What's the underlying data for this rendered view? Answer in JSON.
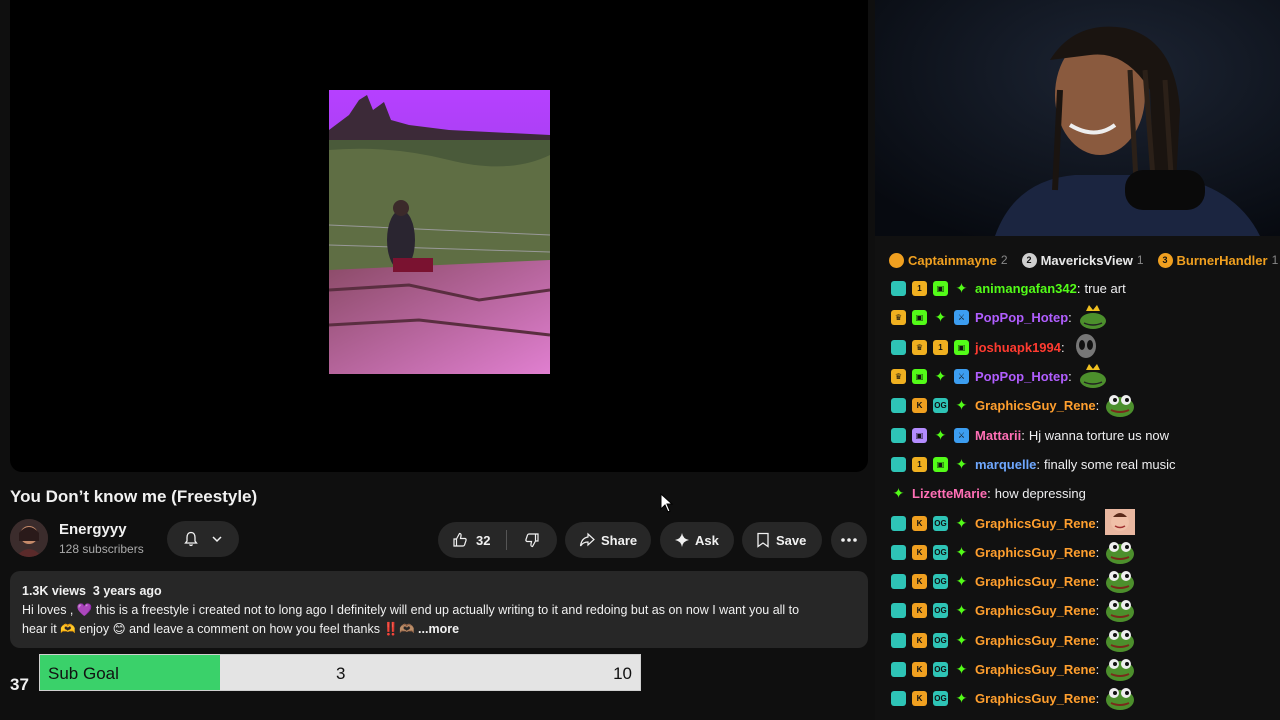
{
  "video": {
    "title": "You Don’t know me (Freestyle)",
    "channel_name": "Energyyy",
    "subscribers": "128 subscribers",
    "likes": "32",
    "share_label": "Share",
    "ask_label": "Ask",
    "save_label": "Save",
    "views": "1.3K views",
    "age": "3 years ago",
    "description_line1": "Hi loves ,  💜  this is a freestyle i created not to long ago I definitely will end up actually writing to it and redoing but as on now I want you all to",
    "description_line2": "hear it 🫶 enjoy 😊 and leave a comment on how you feel thanks ‼️🫶🏽",
    "more_label": "...more",
    "comments_count": "37"
  },
  "sub_goal": {
    "label": "Sub Goal",
    "current": "3",
    "target": "10",
    "progress": 0.3
  },
  "chat": {
    "top_gifters": [
      {
        "name": "Captainmayne",
        "count": "2",
        "rank": "",
        "color": "#f0a020"
      },
      {
        "name": "MavericksView",
        "count": "1",
        "rank": "2",
        "color": "#cfcfcf"
      },
      {
        "name": "BurnerHandler",
        "count": "1",
        "rank": "3",
        "color": "#f0a020"
      }
    ],
    "messages": [
      {
        "user": "animangafan342",
        "color": "#53fc18",
        "text": "true art",
        "badges": [
          "months",
          "gold-1",
          "gift-green",
          "verified"
        ]
      },
      {
        "user": "PopPop_Hotep",
        "color": "#b15eff",
        "text": "",
        "emote": "crown-frog-emote",
        "badges": [
          "crown",
          "gift-green",
          "verified",
          "mod"
        ]
      },
      {
        "user": "joshuapk1994",
        "color": "#ff3b30",
        "text": "",
        "emote": "alien-emote",
        "badges": [
          "months",
          "crown",
          "gold-1",
          "gift-green"
        ]
      },
      {
        "user": "PopPop_Hotep",
        "color": "#b15eff",
        "text": "",
        "emote": "crown-frog-emote",
        "badges": [
          "crown",
          "gift-green",
          "verified",
          "mod"
        ]
      },
      {
        "user": "GraphicsGuy_Rene",
        "color": "#ff9f2e",
        "text": "",
        "emote": "pepe-emote",
        "badges": [
          "months",
          "k",
          "og",
          "verified"
        ]
      },
      {
        "user": "Mattarii",
        "color": "#ff6fb5",
        "text": "Hj wanna torture us now",
        "badges": [
          "months",
          "gift-purple",
          "verified",
          "mod"
        ]
      },
      {
        "user": "marquelle",
        "color": "#6fa8ff",
        "text": "finally some real music",
        "badges": [
          "months",
          "gold-1",
          "gift-green",
          "verified"
        ]
      },
      {
        "user": "LizetteMarie",
        "color": "#ff6fb5",
        "text": "how depressing",
        "badges": [
          "verified"
        ]
      },
      {
        "user": "GraphicsGuy_Rene",
        "color": "#ff9f2e",
        "text": "",
        "emote": "face-emote",
        "badges": [
          "months",
          "k",
          "og",
          "verified"
        ]
      },
      {
        "user": "GraphicsGuy_Rene",
        "color": "#ff9f2e",
        "text": "",
        "emote": "pepe-emote",
        "badges": [
          "months",
          "k",
          "og",
          "verified"
        ]
      },
      {
        "user": "GraphicsGuy_Rene",
        "color": "#ff9f2e",
        "text": "",
        "emote": "pepe-emote",
        "badges": [
          "months",
          "k",
          "og",
          "verified"
        ]
      },
      {
        "user": "GraphicsGuy_Rene",
        "color": "#ff9f2e",
        "text": "",
        "emote": "pepe-emote",
        "badges": [
          "months",
          "k",
          "og",
          "verified"
        ]
      },
      {
        "user": "GraphicsGuy_Rene",
        "color": "#ff9f2e",
        "text": "",
        "emote": "pepe-emote",
        "badges": [
          "months",
          "k",
          "og",
          "verified"
        ]
      },
      {
        "user": "GraphicsGuy_Rene",
        "color": "#ff9f2e",
        "text": "",
        "emote": "pepe-emote",
        "badges": [
          "months",
          "k",
          "og",
          "verified"
        ]
      },
      {
        "user": "GraphicsGuy_Rene",
        "color": "#ff9f2e",
        "text": "",
        "emote": "pepe-emote",
        "badges": [
          "months",
          "k",
          "og",
          "verified"
        ]
      }
    ]
  }
}
